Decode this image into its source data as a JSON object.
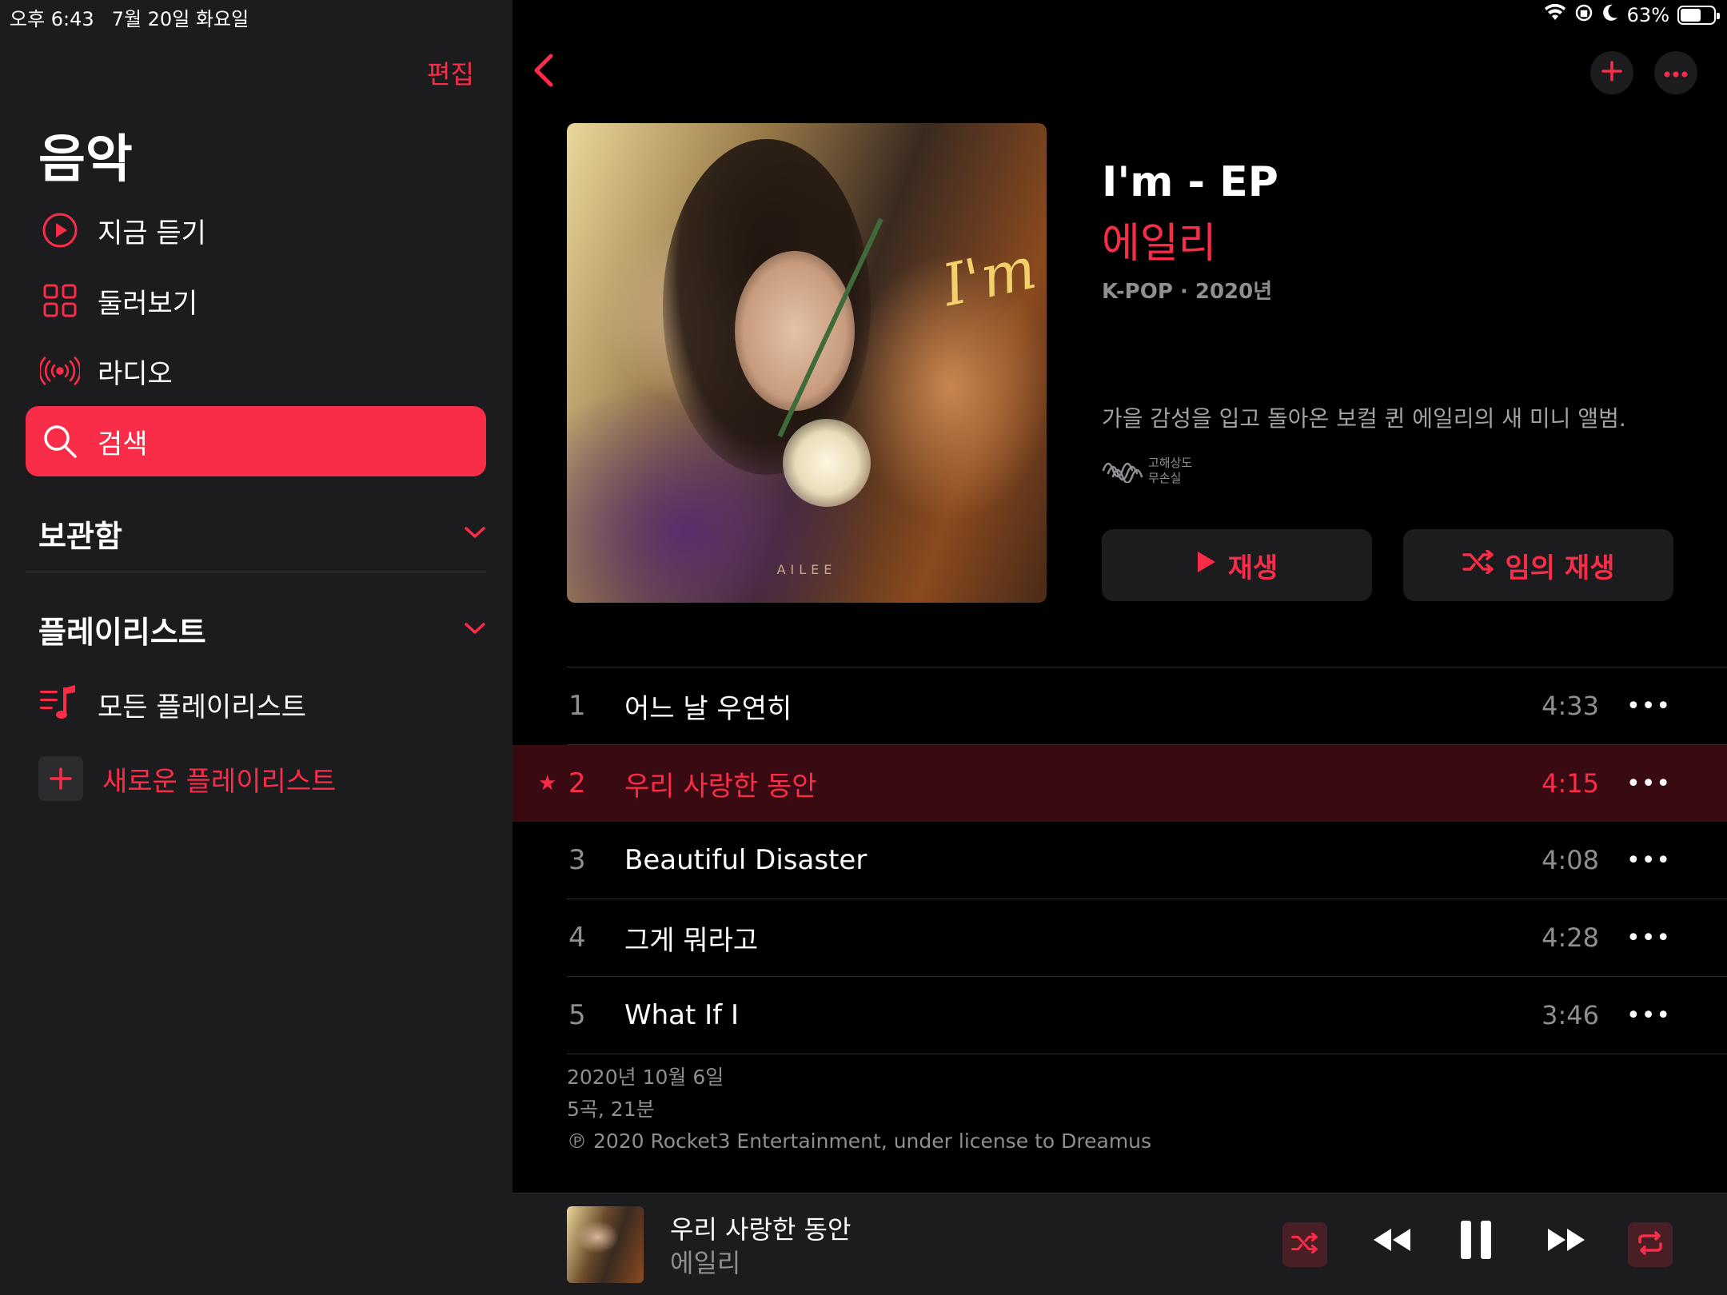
{
  "status": {
    "time": "오후 6:43",
    "date": "7월 20일 화요일",
    "battery": "63%",
    "battery_level": 0.63
  },
  "sidebar": {
    "edit_label": "편집",
    "title": "음악",
    "nav": [
      {
        "label": "지금 듣기",
        "icon": "play-circle-icon"
      },
      {
        "label": "둘러보기",
        "icon": "grid-icon"
      },
      {
        "label": "라디오",
        "icon": "radio-icon"
      },
      {
        "label": "검색",
        "icon": "search-icon",
        "active": true
      }
    ],
    "library_label": "보관함",
    "playlists_label": "플레이리스트",
    "all_playlists_label": "모든 플레이리스트",
    "new_playlist_label": "새로운 플레이리스트"
  },
  "album": {
    "title": "I'm - EP",
    "artist": "에일리",
    "meta": "K-POP · 2020년",
    "description": "가을 감성을 입고 돌아온 보컬 퀸 에일리의 새 미니 앨범.",
    "lossless_line1": "고해상도",
    "lossless_line2": "무손실",
    "art_script": "I'm",
    "art_brand": "AILEE",
    "play_label": "재생",
    "shuffle_label": "임의 재생"
  },
  "tracks": [
    {
      "num": "1",
      "title": "어느 날 우연히",
      "duration": "4:33"
    },
    {
      "num": "2",
      "title": "우리 사랑한 동안",
      "duration": "4:15",
      "playing": true
    },
    {
      "num": "3",
      "title": "Beautiful Disaster",
      "duration": "4:08"
    },
    {
      "num": "4",
      "title": "그게 뭐라고",
      "duration": "4:28"
    },
    {
      "num": "5",
      "title": "What If I",
      "duration": "3:46"
    }
  ],
  "footer": {
    "release_date": "2020년 10월 6일",
    "summary": "5곡, 21분",
    "copyright": "℗ 2020 Rocket3 Entertainment, under license to Dreamus"
  },
  "mini_player": {
    "title": "우리 사랑한 동안",
    "artist": "에일리"
  },
  "colors": {
    "accent": "#fa2d48",
    "sidebar_bg": "#1c1c1e",
    "main_bg": "#000000",
    "playing_row_bg": "#3a0a12"
  }
}
